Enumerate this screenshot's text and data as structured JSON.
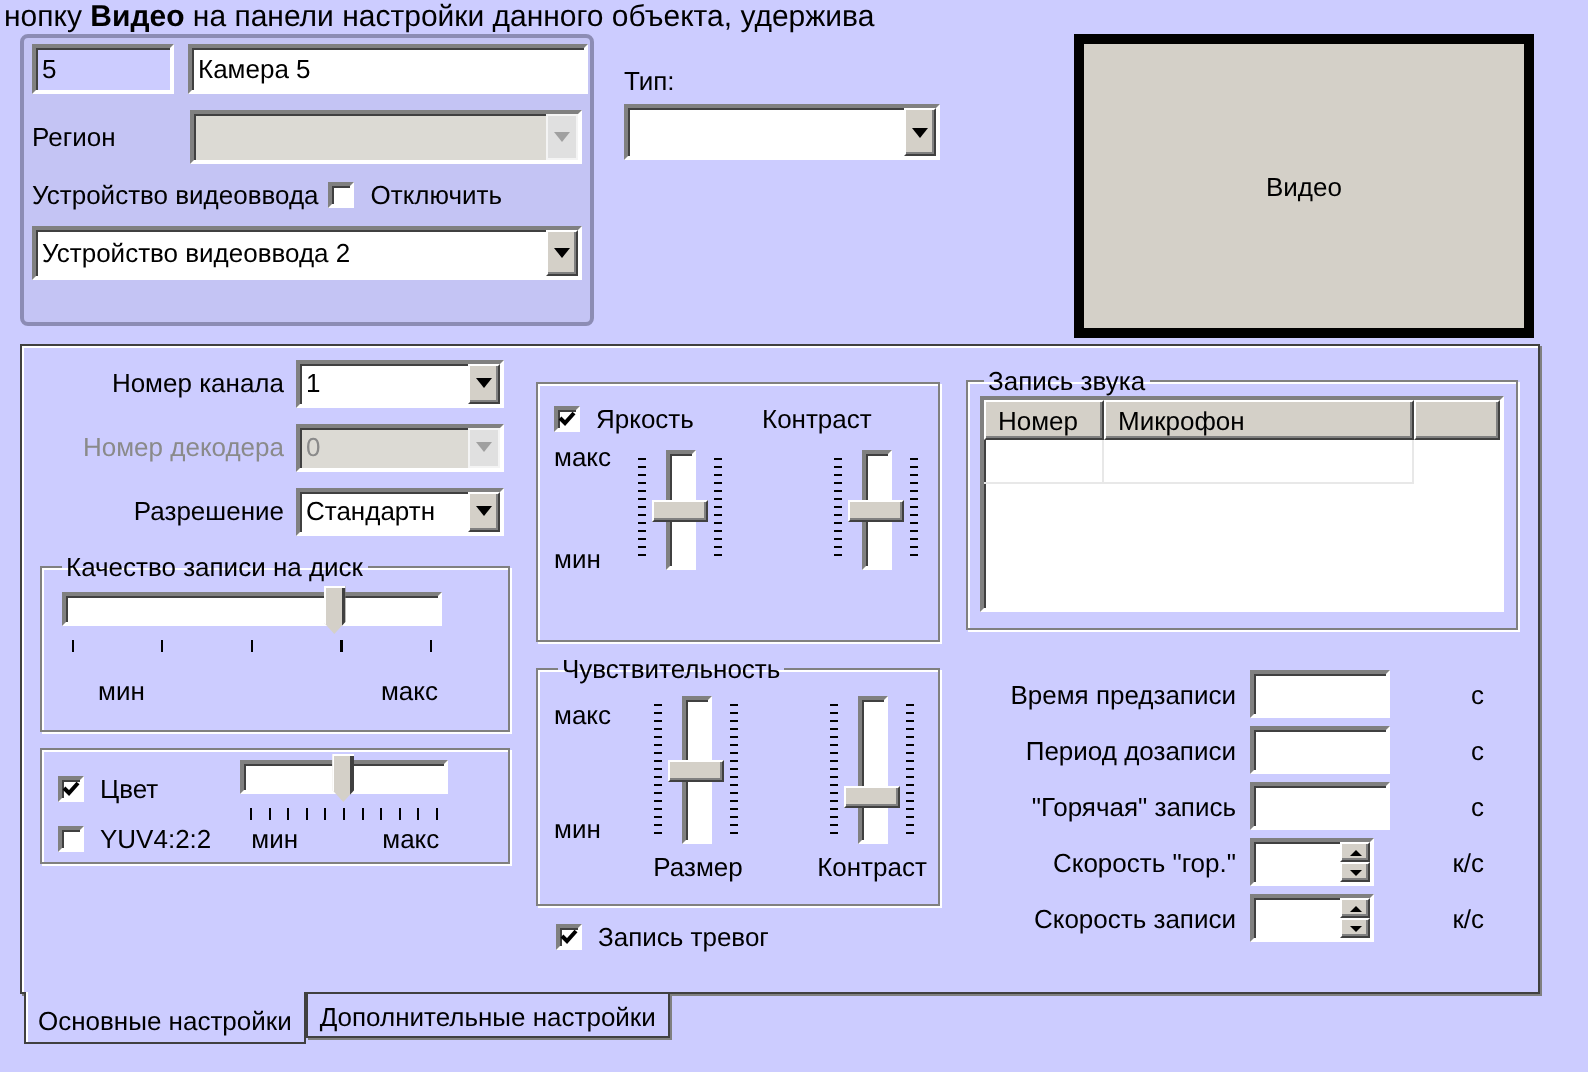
{
  "instruction_text": "нопку **Видео** на панели настройки данного объекта, удержива",
  "camera_panel": {
    "number_field": {
      "value": "5",
      "disabled": true
    },
    "name_field": {
      "value": "Камера 5"
    },
    "region": {
      "label": "Регион",
      "disabled": true
    },
    "video_device": {
      "label": "Устройство видеоввода",
      "disable": {
        "label": "Отключить",
        "checked": false
      },
      "value": "Устройство видеоввода 2"
    }
  },
  "type": {
    "label": "Тип:"
  },
  "video_button": {
    "label": "Видео"
  },
  "main_settings": {
    "channel_fields": [
      {
        "label": "Номер канала",
        "value": "1",
        "disabled": false
      },
      {
        "label": "Номер декодера",
        "value": "0",
        "disabled": true
      },
      {
        "label": "Разрешение",
        "value": "Стандартн",
        "disabled": false
      }
    ],
    "record_quality": {
      "title": "Качество записи на диск",
      "level": 0.73,
      "min": "мин",
      "max": "макс"
    },
    "color": {
      "checks": [
        {
          "label": "Цвет",
          "checked": true
        },
        {
          "label": "YUV4:2:2",
          "checked": false
        }
      ],
      "level": 0.5,
      "min": "мин",
      "max": "макс"
    },
    "image": {
      "brightness": {
        "label": "Яркость",
        "checked": true
      },
      "contrast_label": "Контраст",
      "max": "макс",
      "min": "мин",
      "sliders": [
        {
          "level": 0.5
        },
        {
          "level": 0.5
        }
      ]
    },
    "sensitivity": {
      "title": "Чувствительность",
      "max": "макс",
      "min": "мин",
      "sliders": [
        {
          "label": "Размер",
          "level": 0.5
        },
        {
          "label": "Контраст",
          "level": 0.28
        }
      ]
    },
    "alarm_recording": {
      "label": "Запись тревог",
      "checked": true
    },
    "sound_recording": {
      "title": "Запись звука",
      "columns": [
        "Номер",
        "Микрофон"
      ]
    },
    "timing_fields": [
      {
        "label": "Время предзаписи",
        "unit": "с",
        "kind": "text"
      },
      {
        "label": "Период дозаписи",
        "unit": "с",
        "kind": "text"
      },
      {
        "label": "\"Горячая\" запись",
        "unit": "с",
        "kind": "text"
      },
      {
        "label": "Скорость \"гор.\"",
        "unit": "к/с",
        "kind": "spin"
      },
      {
        "label": "Скорость записи",
        "unit": "к/с",
        "kind": "spin"
      }
    ]
  },
  "tabs": [
    {
      "label": "Основные настройки",
      "selected": true
    },
    {
      "label": "Дополнительные настройки",
      "selected": false
    }
  ]
}
